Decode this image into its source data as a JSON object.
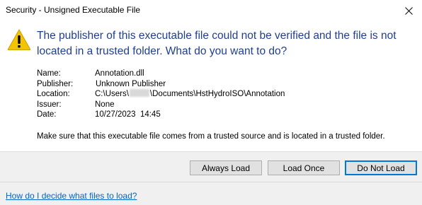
{
  "window": {
    "title": "Security - Unsigned Executable File",
    "close_icon": "close-icon"
  },
  "message": {
    "icon": "warning-icon",
    "headline": "The publisher of this executable file could not be verified and the file is not located in a trusted folder. What do you want to do?"
  },
  "details": {
    "name_label": "Name:",
    "name_value": "Annotation.dll",
    "publisher_label": "Publisher:",
    "publisher_value": "Unknown Publisher",
    "location_label": "Location:",
    "location_prefix": "C:\\Users\\",
    "location_suffix": "\\Documents\\HstHydroISO\\Annotation",
    "issuer_label": "Issuer:",
    "issuer_value": "None",
    "date_label": "Date:",
    "date_value": "10/27/2023  14:45"
  },
  "note": "Make sure that this executable file comes from a trusted source and is located in a trusted folder.",
  "buttons": {
    "always_load": "Always Load",
    "load_once": "Load Once",
    "do_not_load": "Do Not Load"
  },
  "help_link": "How do I decide what files to load?",
  "colors": {
    "headline": "#1f3f8f",
    "link": "#0066cc",
    "warning": "#f5c400",
    "default_button_border": "#0078d7"
  }
}
